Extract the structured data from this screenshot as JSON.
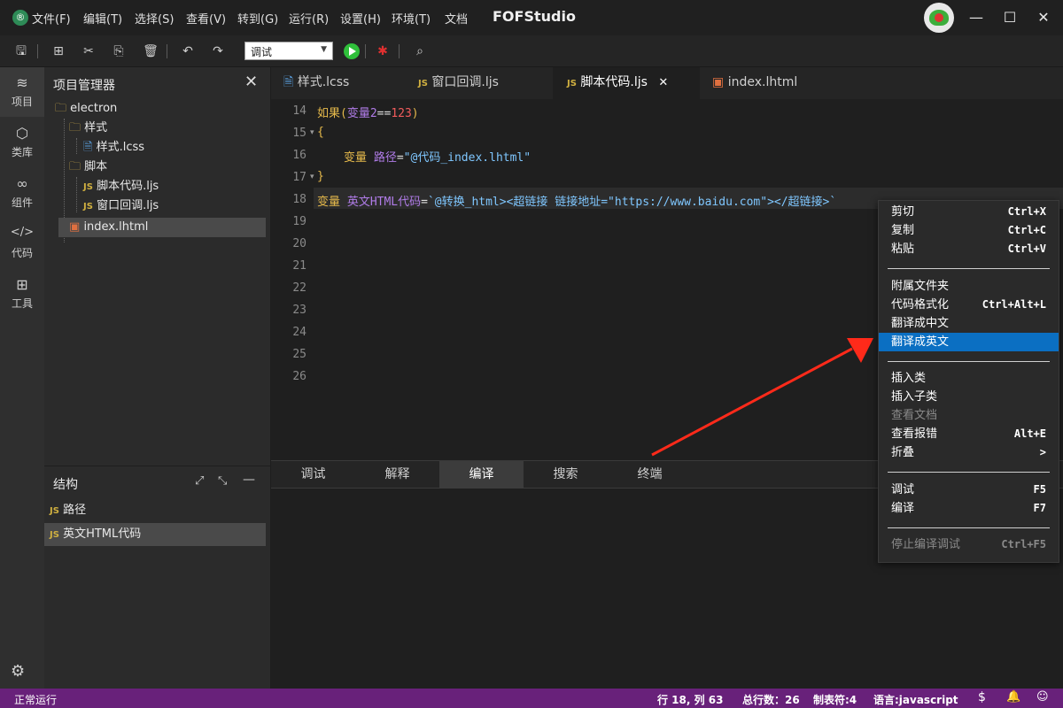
{
  "app": {
    "title": "FOFStudio",
    "logo_icon": "app-logo-icon",
    "menu": [
      "文件(F)",
      "编辑(T)",
      "选择(S)",
      "查看(V)",
      "转到(G)",
      "运行(R)",
      "设置(H)",
      "环境(T)",
      "文档"
    ]
  },
  "toolbar": {
    "mode_select_value": "调试"
  },
  "activity": [
    {
      "label": "项目",
      "icon": "layers-icon"
    },
    {
      "label": "类库",
      "icon": "cube-icon"
    },
    {
      "label": "组件",
      "icon": "link-icon"
    },
    {
      "label": "代码",
      "icon": "code-icon"
    },
    {
      "label": "工具",
      "icon": "tools-icon"
    }
  ],
  "explorer": {
    "title": "项目管理器",
    "tree": [
      {
        "label": "electron",
        "type": "folder"
      },
      {
        "label": "样式",
        "type": "folder"
      },
      {
        "label": "样式.lcss",
        "type": "file"
      },
      {
        "label": "脚本",
        "type": "folder"
      },
      {
        "label": "脚本代码.ljs",
        "type": "js"
      },
      {
        "label": "窗口回调.ljs",
        "type": "js"
      },
      {
        "label": "index.lhtml",
        "type": "html"
      }
    ]
  },
  "structure": {
    "title": "结构",
    "items": [
      {
        "badge": "JS",
        "label": "路径"
      },
      {
        "badge": "JS",
        "label": "英文HTML代码"
      }
    ]
  },
  "tabs": [
    {
      "label": "样式.lcss",
      "badge": ""
    },
    {
      "label": "窗口回调.ljs",
      "badge": "JS"
    },
    {
      "label": "脚本代码.ljs",
      "badge": "JS"
    },
    {
      "label": "index.lhtml",
      "badge": ""
    }
  ],
  "editor": {
    "line_numbers": [
      "14",
      "15",
      "16",
      "17",
      "18",
      "19",
      "20",
      "21",
      "22",
      "23",
      "24",
      "25",
      "26"
    ],
    "lines": {
      "l14": {
        "kw": "如果(",
        "var": "变量2",
        "op": "==",
        "num": "123",
        "end": ")"
      },
      "l15": "{",
      "l16": {
        "kw": "变量 ",
        "var": "路径",
        "op": "=",
        "str": "\"@代码_index.lhtml\""
      },
      "l17": "}",
      "l18": {
        "kw": "变量 ",
        "var": "英文HTML代码",
        "op": "=",
        "str": "`@转换_html><超链接 链接地址=\"https://www.baidu.com\"></超链接>`"
      }
    }
  },
  "panel_tabs": [
    "调试",
    "解释",
    "编译",
    "搜索",
    "终端"
  ],
  "context_menu": {
    "items": [
      {
        "label": "剪切",
        "shortcut": "Ctrl+X"
      },
      {
        "label": "复制",
        "shortcut": "Ctrl+C"
      },
      {
        "label": "粘贴",
        "shortcut": "Ctrl+V"
      },
      {
        "label": "附属文件夹",
        "shortcut": ""
      },
      {
        "label": "代码格式化",
        "shortcut": "Ctrl+Alt+L"
      },
      {
        "label": "翻译成中文",
        "shortcut": ""
      },
      {
        "label": "翻译成英文",
        "shortcut": ""
      },
      {
        "label": "插入类",
        "shortcut": ""
      },
      {
        "label": "插入子类",
        "shortcut": ""
      },
      {
        "label": "查看文档",
        "shortcut": ""
      },
      {
        "label": "查看报错",
        "shortcut": "Alt+E"
      },
      {
        "label": "折叠",
        "shortcut": ">"
      },
      {
        "label": "调试",
        "shortcut": "F5"
      },
      {
        "label": "编译",
        "shortcut": "F7"
      },
      {
        "label": "停止编译调试",
        "shortcut": "Ctrl+F5"
      }
    ]
  },
  "status": {
    "left": "正常运行",
    "position": "行 18, 列 63",
    "total_lines": "总行数：26",
    "tab_size": "制表符:4",
    "language": "语言:javascript"
  },
  "colors": {
    "accent": "#0b6fc2",
    "statusbar": "#68217a",
    "arrow": "#ff2a1a"
  }
}
